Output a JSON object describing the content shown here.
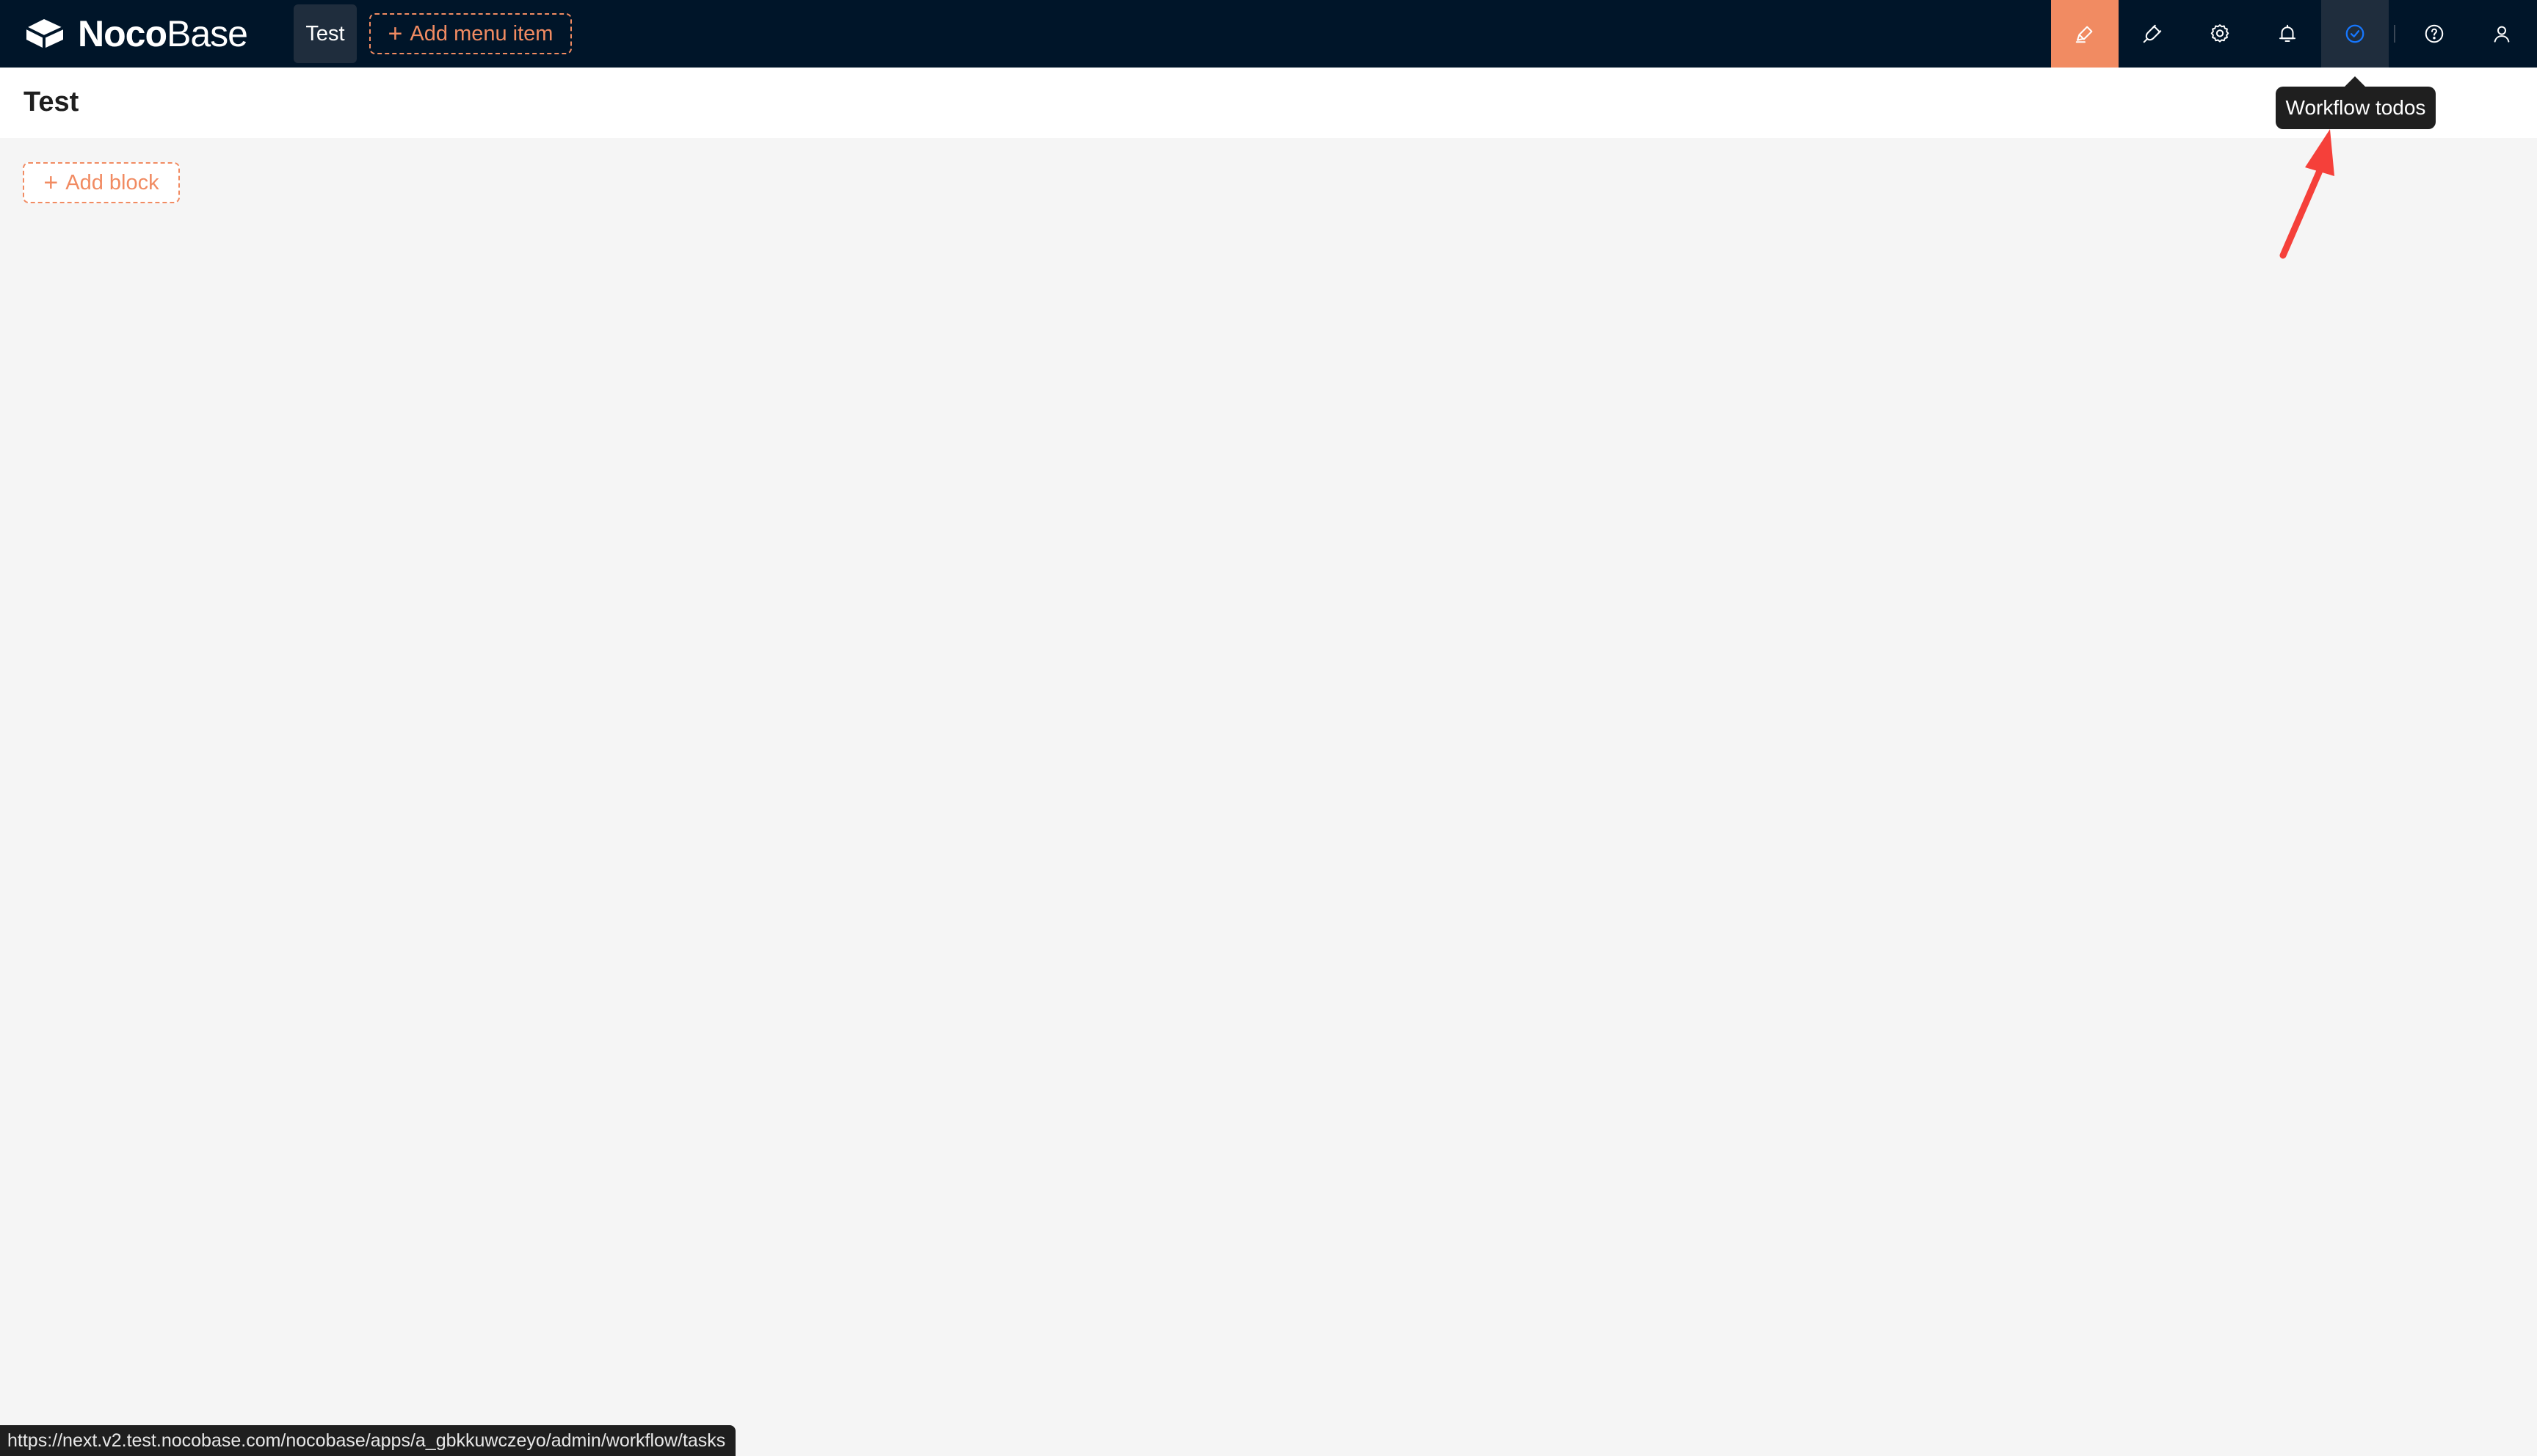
{
  "header": {
    "logo": {
      "brand_bold": "Noco",
      "brand_light": "Base",
      "icon": "nocobase-logo-icon"
    },
    "menu": {
      "tabs": [
        {
          "label": "Test"
        }
      ],
      "add_menu_item_label": "Add menu item"
    },
    "actions": [
      {
        "name": "ui-editor",
        "icon": "highlighter-icon",
        "color": "#f18b62"
      },
      {
        "name": "plugin-manager",
        "icon": "plug-icon"
      },
      {
        "name": "settings",
        "icon": "gear-icon"
      },
      {
        "name": "notifications",
        "icon": "bell-icon"
      },
      {
        "name": "workflow-todos",
        "icon": "check-circle-icon",
        "color": "#1677ff"
      },
      {
        "name": "help",
        "icon": "question-circle-icon"
      },
      {
        "name": "user",
        "icon": "user-icon"
      }
    ]
  },
  "tooltip": {
    "text": "Workflow todos"
  },
  "page": {
    "title": "Test",
    "add_block_label": "Add block"
  },
  "status_bar": {
    "url": "https://next.v2.test.nocobase.com/nocobase/apps/a_gbkkuwczeyo/admin/workflow/tasks"
  },
  "colors": {
    "header_bg": "#001529",
    "accent": "#f18b62",
    "active_icon": "#1677ff",
    "annotation": "#f5403a",
    "page_bg": "#f5f5f5"
  }
}
